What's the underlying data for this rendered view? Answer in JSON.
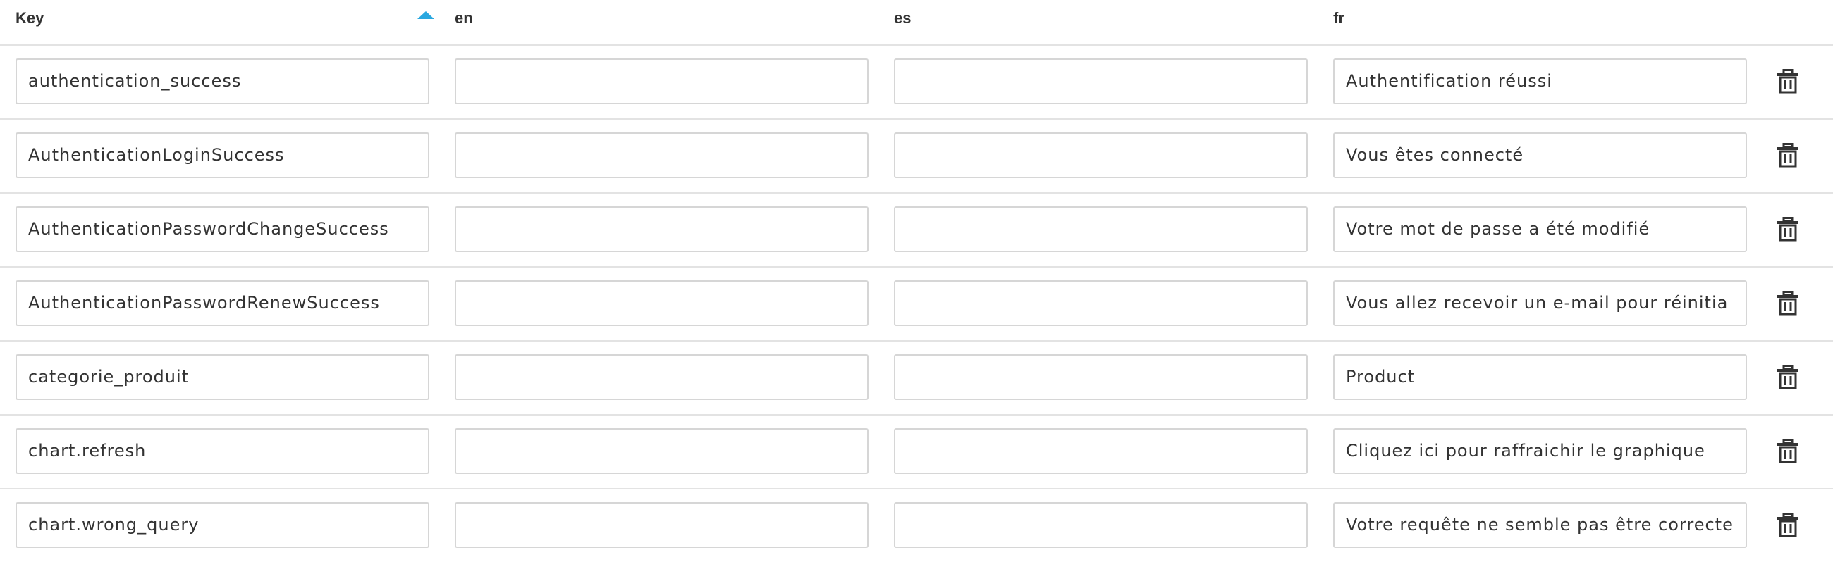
{
  "table": {
    "headers": {
      "key": "Key",
      "en": "en",
      "es": "es",
      "fr": "fr"
    },
    "sort": {
      "column": "Key",
      "direction": "ascending"
    },
    "accent_color": "#2aa8e0",
    "rows": [
      {
        "key": "authentication_success",
        "en": "",
        "es": "",
        "fr": "Authentification réussi"
      },
      {
        "key": "AuthenticationLoginSuccess",
        "en": "",
        "es": "",
        "fr": "Vous êtes connecté"
      },
      {
        "key": "AuthenticationPasswordChangeSuccess",
        "en": "",
        "es": "",
        "fr": "Votre mot de passe a été modifié"
      },
      {
        "key": "AuthenticationPasswordRenewSuccess",
        "en": "",
        "es": "",
        "fr": "Vous allez recevoir un e-mail pour réinitia"
      },
      {
        "key": "categorie_produit",
        "en": "",
        "es": "",
        "fr": "Product"
      },
      {
        "key": "chart.refresh",
        "en": "",
        "es": "",
        "fr": "Cliquez ici pour raffraichir le graphique"
      },
      {
        "key": "chart.wrong_query",
        "en": "",
        "es": "",
        "fr": "Votre requête ne semble pas être correcte"
      }
    ],
    "row_action_icon": "trash-icon"
  }
}
